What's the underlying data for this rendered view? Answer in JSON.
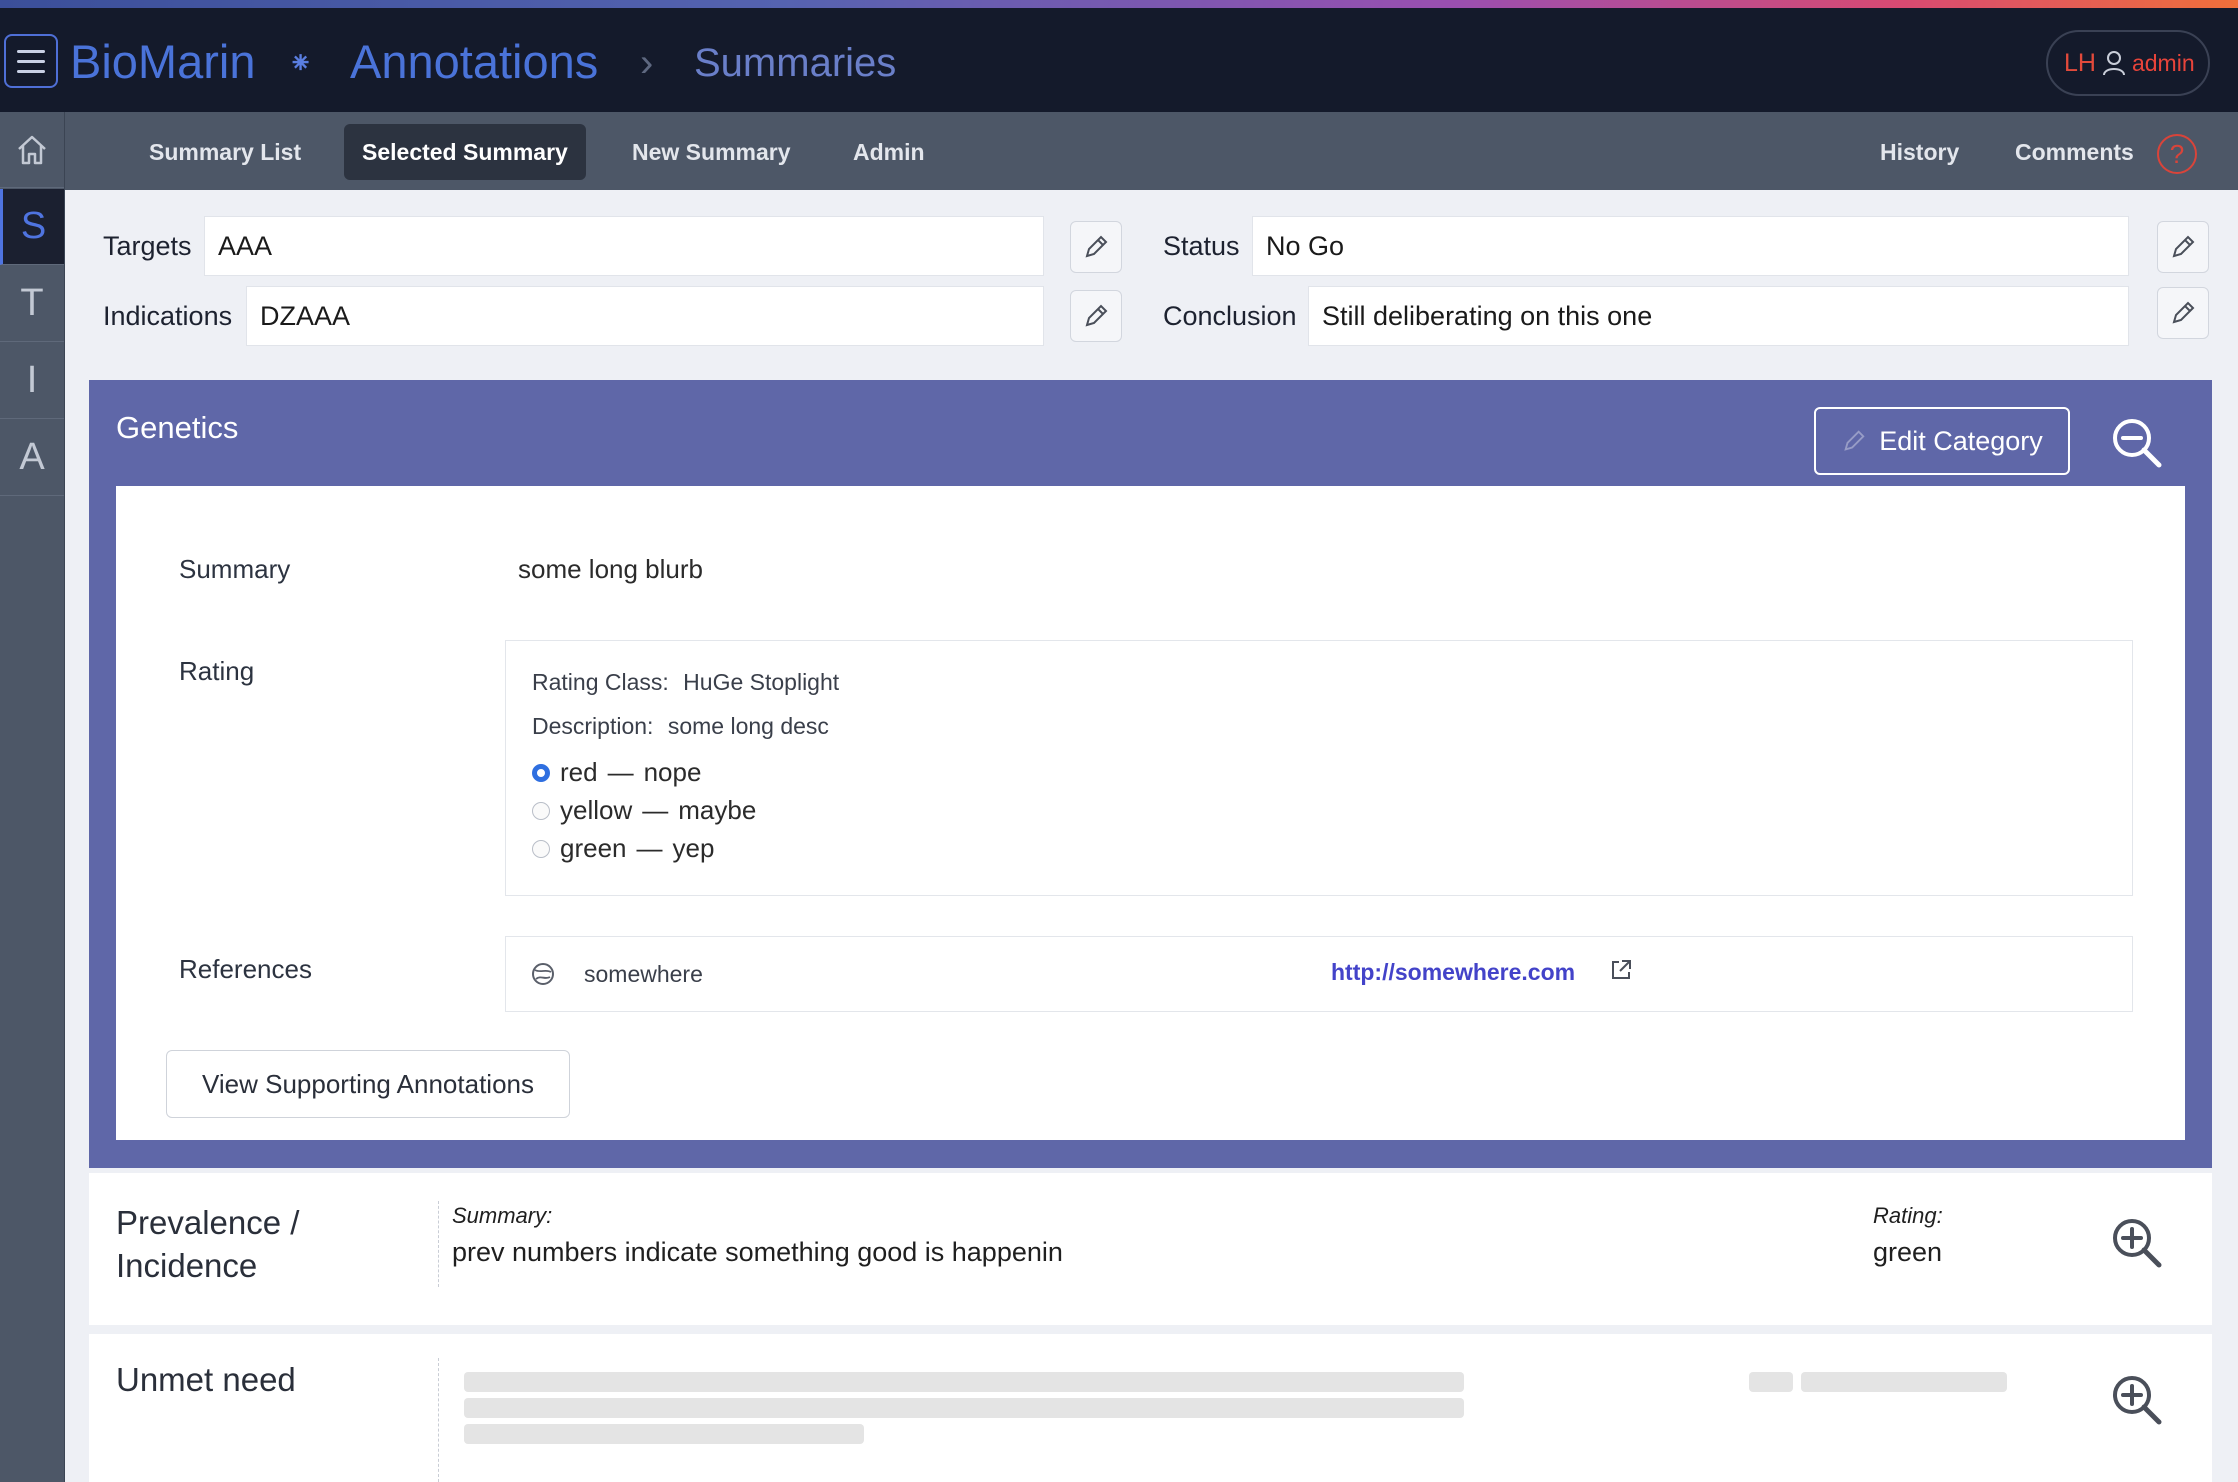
{
  "header": {
    "brand": "BioMarin",
    "brand_separator": "⁕",
    "crumb_root": "Annotations",
    "crumb_separator": "›",
    "crumb_current": "Summaries",
    "user_initials": "LH",
    "user_name": "admin"
  },
  "nav": {
    "left": [
      "Summary List",
      "Selected Summary",
      "New Summary",
      "Admin"
    ],
    "active": "Selected Summary",
    "right": [
      "History",
      "Comments"
    ],
    "help_glyph": "?"
  },
  "rail": {
    "items": [
      "S",
      "T",
      "I",
      "A"
    ],
    "active": "S"
  },
  "fields": {
    "targets_label": "Targets",
    "targets_value": "AAA",
    "indications_label": "Indications",
    "indications_value": "DZAAA",
    "status_label": "Status",
    "status_value": "No Go",
    "conclusion_label": "Conclusion",
    "conclusion_value": "Still deliberating on this one"
  },
  "genetics": {
    "title": "Genetics",
    "edit_button": "Edit Category",
    "summary_label": "Summary",
    "summary_value": "some long blurb",
    "rating_label": "Rating",
    "rating_class_label": "Rating Class:",
    "rating_class_value": "HuGe Stoplight",
    "description_label": "Description:",
    "description_value": "some long desc",
    "options": [
      {
        "value": "red",
        "meaning": "nope",
        "checked": true
      },
      {
        "value": "yellow",
        "meaning": "maybe",
        "checked": false
      },
      {
        "value": "green",
        "meaning": "yep",
        "checked": false
      }
    ],
    "option_dash": "—",
    "references_label": "References",
    "reference_name": "somewhere",
    "reference_url": "http://somewhere.com",
    "view_button": "View Supporting Annotations"
  },
  "prevalence": {
    "title_line1": "Prevalence /",
    "title_line2": "Incidence",
    "summary_label": "Summary:",
    "summary_value": "prev numbers indicate something good is happenin",
    "rating_label": "Rating:",
    "rating_value": "green"
  },
  "unmet": {
    "title": "Unmet need"
  },
  "colors": {
    "header_bg": "#141a2b",
    "nav_bg": "#4d5767",
    "brand_blue": "#4a73d9",
    "category_bg": "#5f67a8",
    "user_red": "#e24a3b",
    "link": "#4343c9",
    "radio_checked": "#2f6fe0"
  },
  "icons": [
    "menu-icon",
    "home-icon",
    "pencil-icon",
    "search-minus-icon",
    "search-plus-icon",
    "globe-icon",
    "external-link-icon",
    "user-icon",
    "help-icon"
  ]
}
